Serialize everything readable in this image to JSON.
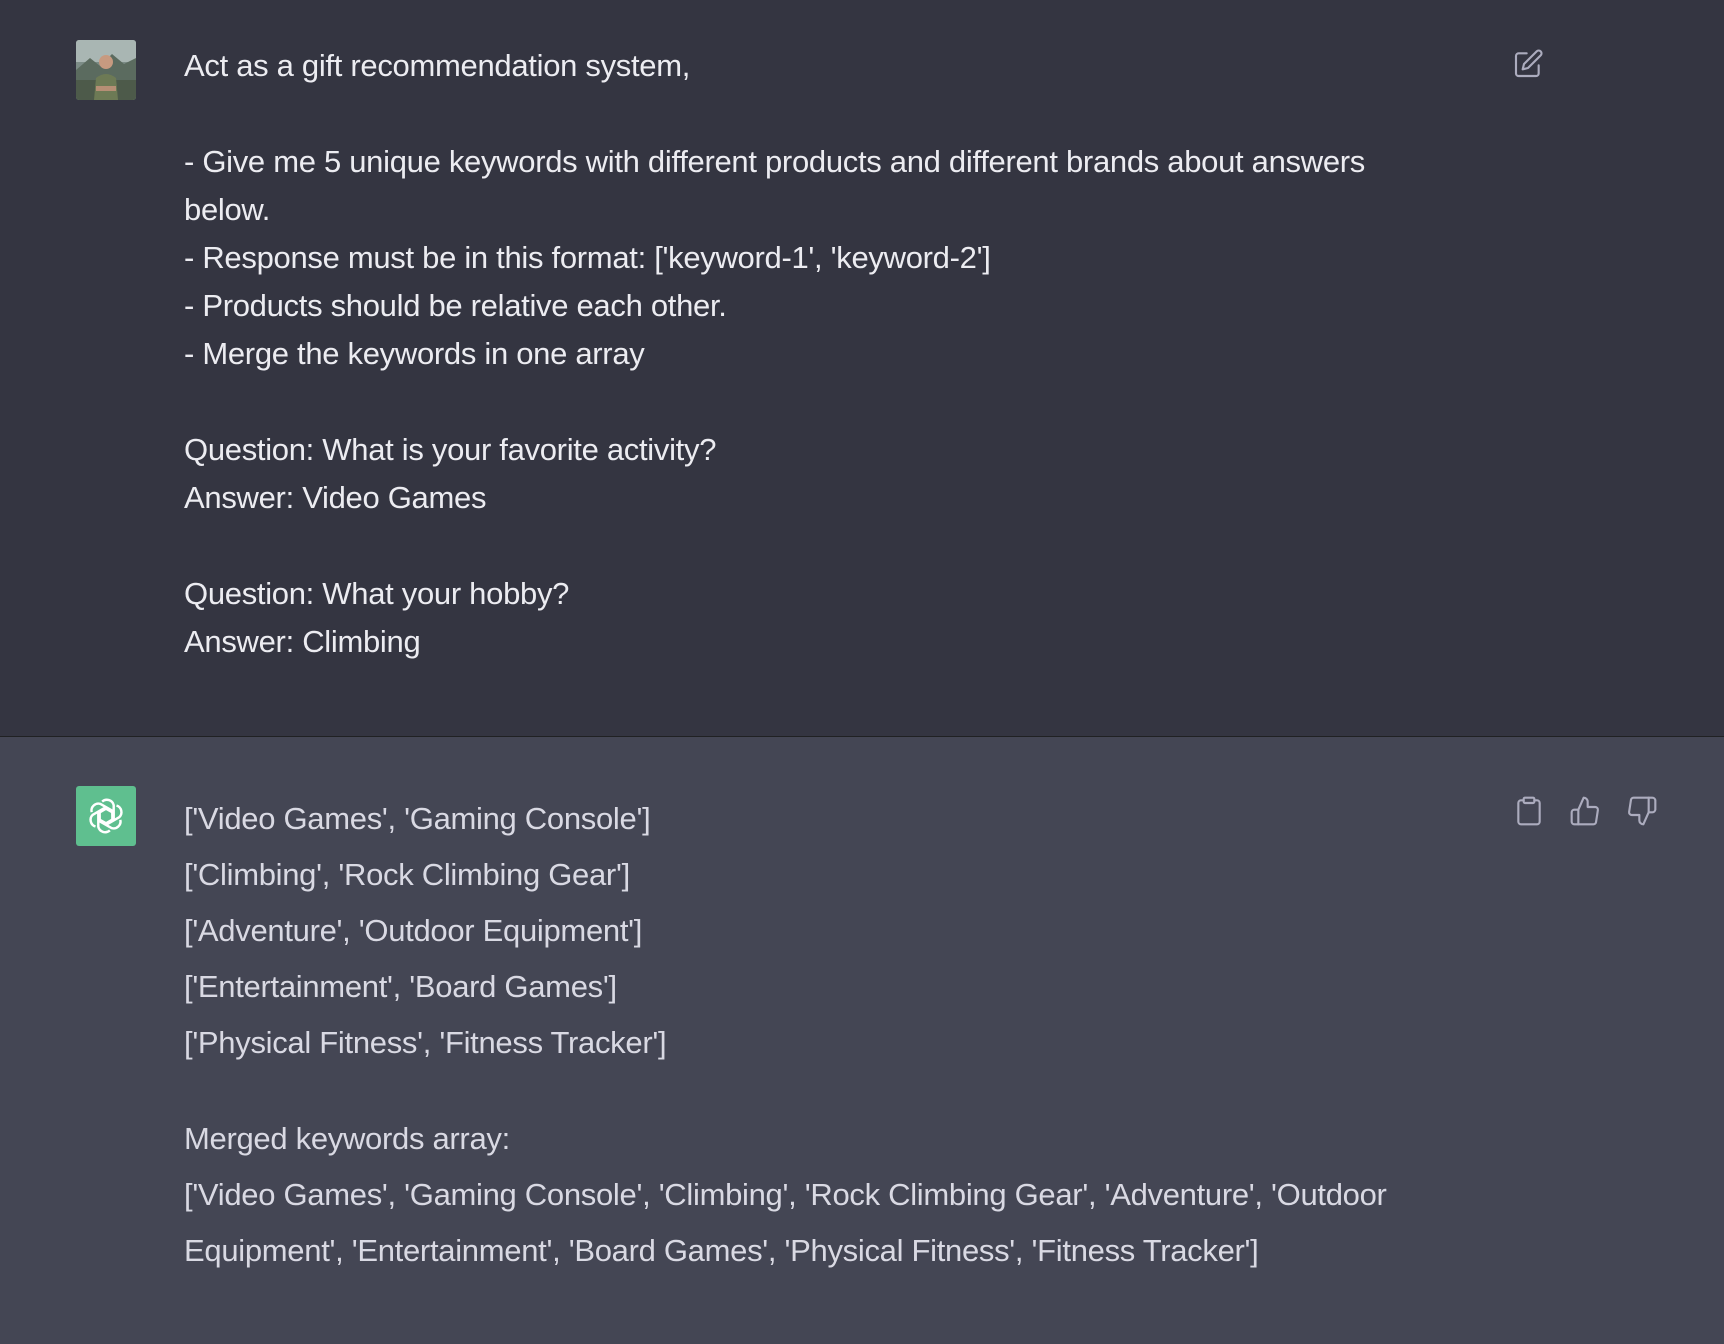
{
  "user_message": {
    "lines": [
      "Act as a gift recommendation system,",
      "",
      "- Give me 5 unique keywords with different products and different brands about answers below.",
      "- Response must be in this format: ['keyword-1', 'keyword-2']",
      "- Products should be relative each other.",
      "- Merge the keywords in one array",
      "",
      "Question: What is your favorite activity?",
      "Answer: Video Games",
      "",
      "Question: What your hobby?",
      "Answer: Climbing"
    ],
    "edit_icon": "edit-icon"
  },
  "assistant_message": {
    "pairs": [
      "['Video Games', 'Gaming Console']",
      "['Climbing', 'Rock Climbing Gear']",
      "['Adventure', 'Outdoor Equipment']",
      "['Entertainment', 'Board Games']",
      "['Physical Fitness', 'Fitness Tracker']"
    ],
    "merged_label": "Merged keywords array:",
    "merged_line_1": "['Video Games', 'Gaming Console', 'Climbing', 'Rock Climbing Gear', 'Adventure', 'Outdoor",
    "merged_line_2": "Equipment', 'Entertainment', 'Board Games', 'Physical Fitness', 'Fitness Tracker']",
    "action_icons": [
      "clipboard-icon",
      "thumbs-up-icon",
      "thumbs-down-icon"
    ]
  },
  "colors": {
    "user_bg": "#343541",
    "assistant_bg": "#444654",
    "bot_avatar": "#5fbf8f",
    "text": "#ececf1"
  }
}
